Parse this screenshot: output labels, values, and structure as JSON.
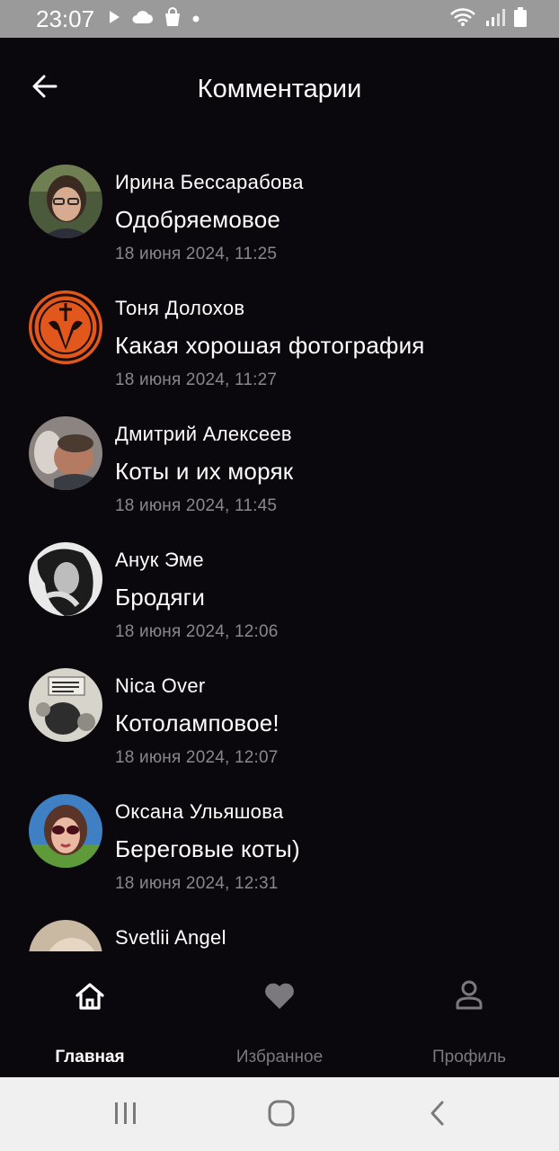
{
  "status_bar": {
    "time": "23:07",
    "left_icons": [
      "play-icon",
      "cloud-icon",
      "shopping-bag-icon",
      "dot-icon"
    ],
    "right_icons": [
      "wifi-icon",
      "signal-icon",
      "battery-icon"
    ]
  },
  "header": {
    "title": "Комментарии",
    "back_icon": "arrow-left-icon"
  },
  "comments": [
    {
      "author": "Ирина Бессарабова",
      "text": "Одобряемовое",
      "date": "18 июня 2024, 11:25"
    },
    {
      "author": "Тоня Долохов",
      "text": "Какая хорошая фотография",
      "date": "18 июня 2024, 11:27"
    },
    {
      "author": "Дмитрий Алексеев",
      "text": "Коты и их моряк",
      "date": "18 июня 2024, 11:45"
    },
    {
      "author": "Анук Эме",
      "text": "Бродяги",
      "date": "18 июня 2024, 12:06"
    },
    {
      "author": "Nica Over",
      "text": "Котоламповое!",
      "date": "18 июня 2024, 12:07"
    },
    {
      "author": "Оксана Ульяшова",
      "text": "Береговые коты)",
      "date": "18 июня 2024, 12:31"
    },
    {
      "author": "Svetlii Angel",
      "text": "",
      "date": ""
    }
  ],
  "bottom_nav": {
    "items": [
      {
        "label": "Главная",
        "icon": "home-icon",
        "active": true
      },
      {
        "label": "Избранное",
        "icon": "heart-icon",
        "active": false
      },
      {
        "label": "Профиль",
        "icon": "person-icon",
        "active": false
      }
    ]
  },
  "system_nav": [
    "recent-apps-icon",
    "home-circle-icon",
    "back-chevron-icon"
  ],
  "colors": {
    "background": "#0b080d",
    "text_primary": "#ffffff",
    "text_secondary": "#8a878c",
    "nav_inactive": "#7c797e",
    "status_bar": "#9a9a9a",
    "system_nav": "#f1f0f1"
  }
}
